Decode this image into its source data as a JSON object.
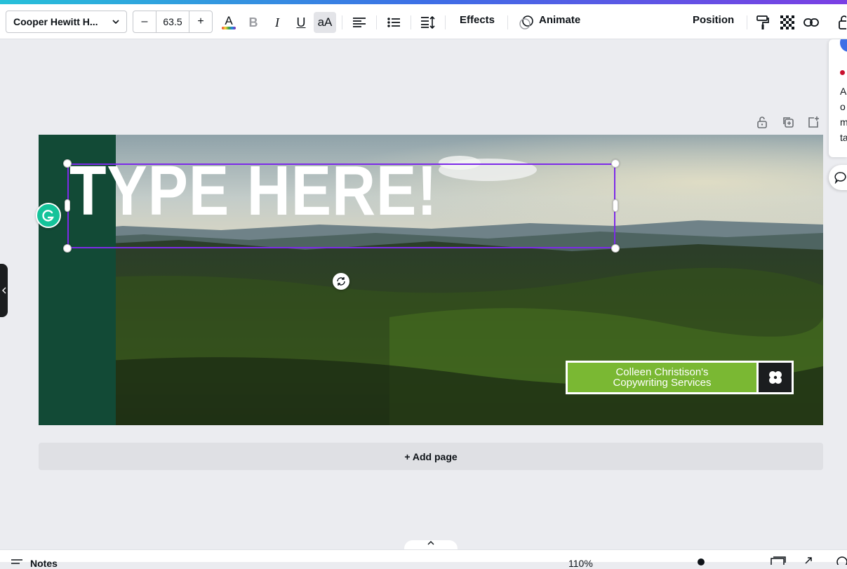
{
  "toolbar": {
    "font_name": "Cooper Hewitt H...",
    "font_size": "63.5",
    "decrease_label": "–",
    "increase_label": "+",
    "bold_label": "B",
    "italic_label": "I",
    "underline_label": "U",
    "case_label": "aA",
    "color_label": "A",
    "effects_label": "Effects",
    "animate_label": "Animate",
    "position_label": "Position"
  },
  "canvas": {
    "headline": "TYPE HERE!",
    "brand_line1": "Colleen Christison's",
    "brand_line2": "Copywriting Services",
    "add_page_label": "+ Add page"
  },
  "right_panel": {
    "lines": [
      "A",
      "o",
      "m",
      "ta"
    ]
  },
  "bottom_bar": {
    "notes_label": "Notes",
    "zoom_label": "110%"
  },
  "colors": {
    "accent": "#7d2ae8",
    "strip_green": "#124a36",
    "brand_green": "#7ab833",
    "grammarly": "#15c39a"
  }
}
